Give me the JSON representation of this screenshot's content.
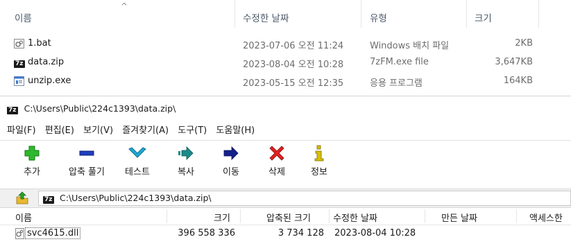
{
  "explorer": {
    "headers": {
      "name": "이름",
      "modified": "수정한 날짜",
      "type": "유형",
      "size": "크기"
    },
    "sort_indicator": "^",
    "files": [
      {
        "name": "1.bat",
        "modified": "2023-07-06 오전 11:24",
        "type": "Windows 배치 파일",
        "size": "2KB",
        "icon": "batch-file-icon"
      },
      {
        "name": "data.zip",
        "modified": "2023-08-04 오전 10:28",
        "type": "7zFM.exe file",
        "size": "3,647KB",
        "icon": "7zip-archive-icon"
      },
      {
        "name": "unzip.exe",
        "modified": "2023-05-15 오전 12:35",
        "type": "응용 프로그램",
        "size": "164KB",
        "icon": "exe-file-icon"
      }
    ]
  },
  "sevenzip": {
    "title": "C:\\Users\\Public\\224c1393\\data.zip\\",
    "app_badge": "7z",
    "menu": [
      "파일(F)",
      "편집(E)",
      "보기(V)",
      "즐겨찾기(A)",
      "도구(T)",
      "도움말(H)"
    ],
    "toolbar": [
      "추가",
      "압축 풀기",
      "테스트",
      "복사",
      "이동",
      "삭제",
      "정보"
    ],
    "address": "C:\\Users\\Public\\224c1393\\data.zip\\",
    "list_headers": {
      "name": "이름",
      "size": "크기",
      "packed": "압축된 크기",
      "modified": "수정한 날짜",
      "created": "만든 날짜",
      "accessed": "액세스한"
    },
    "rows": [
      {
        "name": "svc4615.dll",
        "size": "396 558 336",
        "packed": "3 734 128",
        "modified": "2023-08-04 10:28"
      }
    ]
  },
  "colors": {
    "add": "#2db82d",
    "extract": "#1f3fbf",
    "test": "#1fa9d6",
    "copy": "#1c8a8a",
    "move": "#14208a",
    "delete": "#e02020",
    "info": "#c9b400"
  }
}
